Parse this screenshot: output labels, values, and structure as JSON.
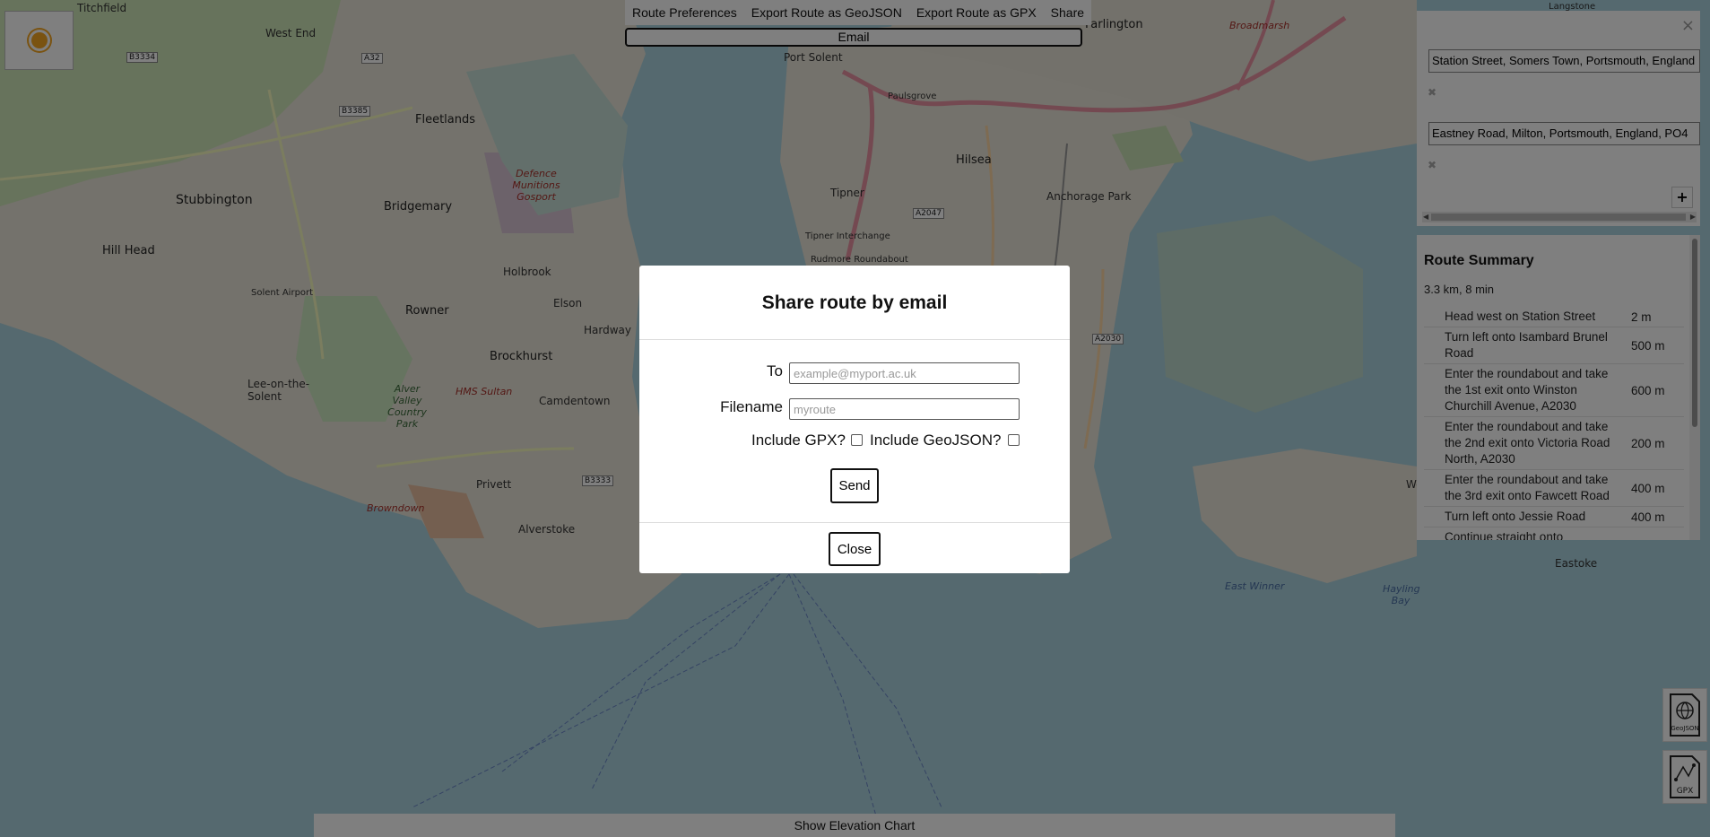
{
  "map": {
    "labels": {
      "titchfield": "Titchfield",
      "west_end": "West End",
      "fleetlands": "Fleetlands",
      "port_solent": "Port Solent",
      "paulsgrove": "Paulsgrove",
      "hilsea": "Hilsea",
      "tipner": "Tipner",
      "tipner_interchange": "Tipner Interchange",
      "rudmore": "Rudmore Roundabout",
      "farlington": "Farlington",
      "anchorage_park": "Anchorage Park",
      "stubbington": "Stubbington",
      "bridgemary": "Bridgemary",
      "defence": "Defence Munitions Gosport",
      "hill_head": "Hill Head",
      "holbrook": "Holbrook",
      "solent_airport": "Solent Airport",
      "rowner": "Rowner",
      "elson": "Elson",
      "hardway": "Hardway",
      "brockhurst": "Brockhurst",
      "lee_on_the_solent": "Lee-on-the-Solent",
      "alver_valley": "Alver Valley Country Park",
      "hms_sultan": "HMS Sultan",
      "camdentown": "Camdentown",
      "privett": "Privett",
      "alverstoke": "Alverstoke",
      "browndown": "Browndown",
      "west_town": "West Town",
      "eastoke": "Eastoke",
      "langstone": "Langstone",
      "broadmarsh": "Broadmarsh",
      "east_winner": "East Winner",
      "hayling_bay": "Hayling Bay",
      "b3334": "B3334",
      "a32": "A32",
      "b3385": "B3385",
      "b3333": "B3333",
      "a2047": "A2047",
      "a2030": "A2030"
    }
  },
  "theme_icon": "sun-icon",
  "top_menu": {
    "items": [
      "Route Preferences",
      "Export Route as GeoJSON",
      "Export Route as GPX",
      "Share"
    ],
    "email_label": "Email"
  },
  "route": {
    "close_label": "×",
    "start": "Station Street, Somers Town, Portsmouth, England",
    "end": "Eastney Road, Milton, Portsmouth, England, PO4",
    "remove_label": "✖",
    "add_label": "+"
  },
  "summary": {
    "title": "Route Summary",
    "meta": "3.3 km, 8 min",
    "steps": [
      {
        "text": "Head west on Station Street",
        "dist": "2 m"
      },
      {
        "text": "Turn left onto Isambard Brunel Road",
        "dist": "500 m"
      },
      {
        "text": "Enter the roundabout and take the 1st exit onto Winston Churchill Avenue, A2030",
        "dist": "600 m"
      },
      {
        "text": "Enter the roundabout and take the 2nd exit onto Victoria Road North, A2030",
        "dist": "200 m"
      },
      {
        "text": "Enter the roundabout and take the 3rd exit onto Fawcett Road",
        "dist": "400 m"
      },
      {
        "text": "Turn left onto Jessie Road",
        "dist": "400 m"
      },
      {
        "text": "Continue straight onto Devonshire",
        "dist": ""
      }
    ]
  },
  "downloads": {
    "geojson_label": "GeoJSON",
    "gpx_label": "GPX"
  },
  "elevation": {
    "label": "Show Elevation Chart"
  },
  "modal": {
    "title": "Share route by email",
    "to_label": "To",
    "to_placeholder": "example@myport.ac.uk",
    "filename_label": "Filename",
    "filename_placeholder": "myroute",
    "gpx_label": "Include GPX?",
    "geojson_label": "Include GeoJSON?",
    "send_label": "Send",
    "close_label": "Close"
  }
}
